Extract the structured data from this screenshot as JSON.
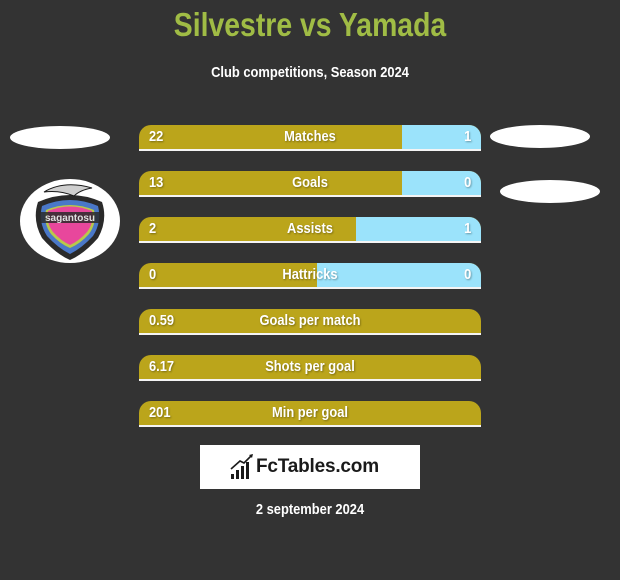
{
  "header": {
    "title": "Silvestre vs Yamada",
    "subtitle": "Club competitions, Season 2024"
  },
  "colors": {
    "title": "#a0bc45",
    "left_bar": "#bba51b",
    "right_bar": "#9be3fb",
    "background": "#333333"
  },
  "left_team": {
    "logo": "sagan-tosu-crest",
    "logo_text": "sagantosu"
  },
  "stats": [
    {
      "label": "Matches",
      "left": "22",
      "right": "1",
      "left_share": 0.77
    },
    {
      "label": "Goals",
      "left": "13",
      "right": "0",
      "left_share": 0.77
    },
    {
      "label": "Assists",
      "left": "2",
      "right": "1",
      "left_share": 0.635
    },
    {
      "label": "Hattricks",
      "left": "0",
      "right": "0",
      "left_share": 0.52
    },
    {
      "label": "Goals per match",
      "left": "0.59",
      "right": null,
      "left_share": 1
    },
    {
      "label": "Shots per goal",
      "left": "6.17",
      "right": null,
      "left_share": 1
    },
    {
      "label": "Min per goal",
      "left": "201",
      "right": null,
      "left_share": 1
    }
  ],
  "brand": {
    "icon": "bar-chart-icon",
    "text": "FcTables.com"
  },
  "footer": {
    "date": "2 september 2024"
  }
}
